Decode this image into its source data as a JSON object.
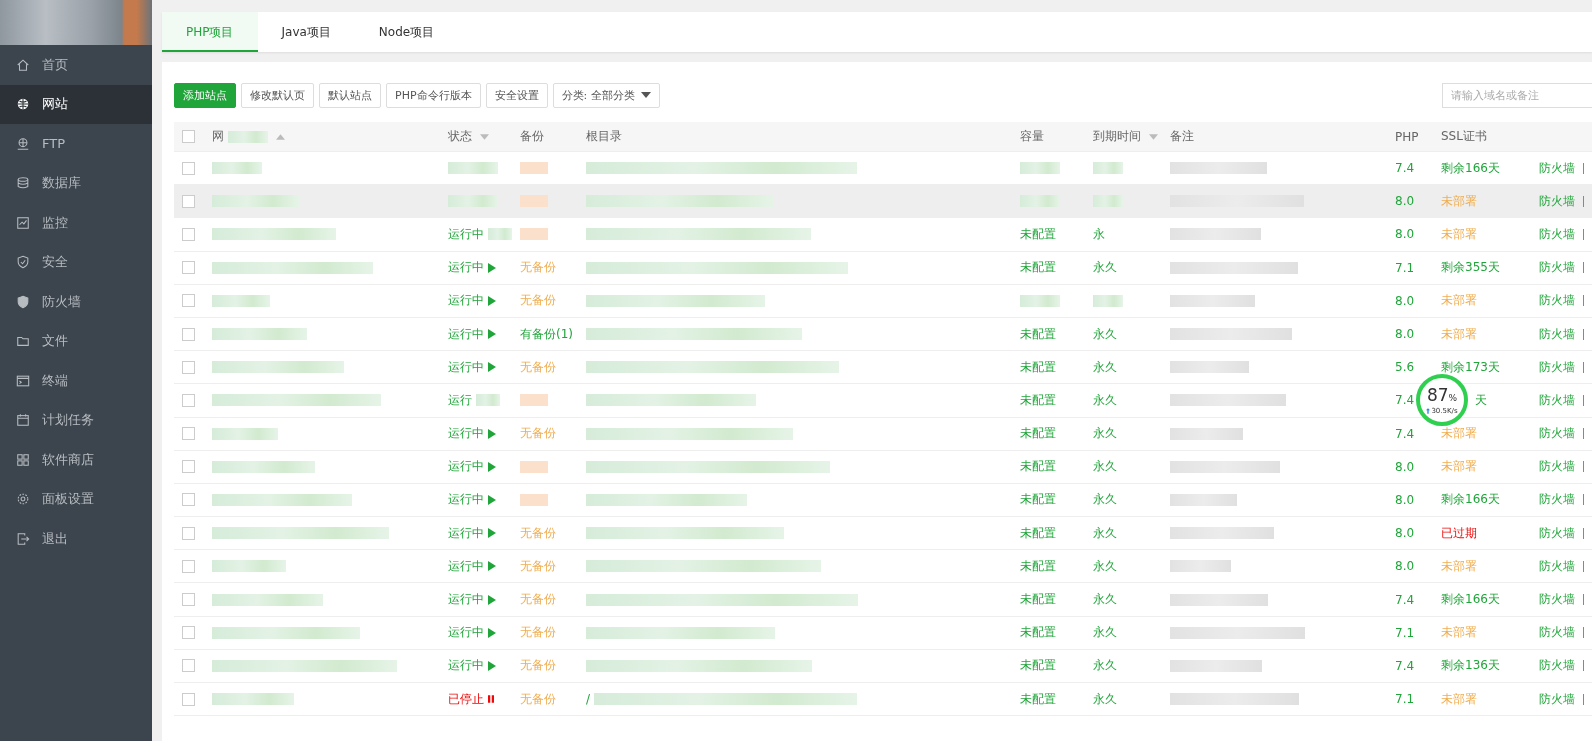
{
  "sidebar": {
    "items": [
      {
        "label": "首页",
        "selected": false
      },
      {
        "label": "网站",
        "selected": true
      },
      {
        "label": "FTP",
        "selected": false
      },
      {
        "label": "数据库",
        "selected": false
      },
      {
        "label": "监控",
        "selected": false
      },
      {
        "label": "安全",
        "selected": false
      },
      {
        "label": "防火墙",
        "selected": false
      },
      {
        "label": "文件",
        "selected": false
      },
      {
        "label": "终端",
        "selected": false
      },
      {
        "label": "计划任务",
        "selected": false
      },
      {
        "label": "软件商店",
        "selected": false
      },
      {
        "label": "面板设置",
        "selected": false
      },
      {
        "label": "退出",
        "selected": false
      }
    ]
  },
  "tabs": [
    {
      "label": "PHP项目",
      "selected": true
    },
    {
      "label": "Java项目",
      "selected": false
    },
    {
      "label": "Node项目",
      "selected": false
    }
  ],
  "toolbar": {
    "buttons": [
      {
        "label": "添加站点",
        "kind": "primary"
      },
      {
        "label": "修改默认页",
        "kind": "default"
      },
      {
        "label": "默认站点",
        "kind": "default"
      },
      {
        "label": "PHP命令行版本",
        "kind": "default"
      },
      {
        "label": "安全设置",
        "kind": "default"
      },
      {
        "label": "分类: 全部分类",
        "kind": "dropdown"
      }
    ],
    "search": {
      "placeholder": "请输入域名或备注"
    }
  },
  "table": {
    "header_checked": false,
    "columns": [
      {
        "label": "网",
        "sort_ascending": true
      },
      {
        "label": "状态",
        "sort_ascending": false
      },
      {
        "label": "备份"
      },
      {
        "label": "根目录"
      },
      {
        "label": "容量"
      },
      {
        "label": "到期时间",
        "sort_ascending": false
      },
      {
        "label": "备注"
      },
      {
        "label": "PHP"
      },
      {
        "label": "SSL证书"
      }
    ],
    "rows": [
      {
        "checked": false,
        "selected": false,
        "php": "7.4",
        "ssl": "剩余166天",
        "ssl_deployed": true,
        "ssl_expired": false,
        "actions": [
          "防火墙"
        ]
      },
      {
        "checked": false,
        "selected": true,
        "php": "8.0",
        "ssl": "未部署",
        "ssl_deployed": false,
        "ssl_expired": false,
        "actions": [
          "防火墙"
        ]
      },
      {
        "checked": false,
        "selected": false,
        "status": "运行中",
        "running": true,
        "partial": true,
        "capacity": "未配置",
        "expiry": "永",
        "php": "8.0",
        "ssl": "未部署",
        "ssl_deployed": false,
        "ssl_expired": false,
        "actions": [
          "防火墙"
        ]
      },
      {
        "checked": false,
        "selected": false,
        "status": "运行中",
        "running": true,
        "partial": false,
        "backup": "无备份",
        "has_backup": false,
        "capacity": "未配置",
        "expiry": "永久",
        "php": "7.1",
        "ssl": "剩余355天",
        "ssl_deployed": true,
        "ssl_expired": false,
        "actions": [
          "防火墙"
        ]
      },
      {
        "checked": false,
        "selected": false,
        "status": "运行中",
        "running": true,
        "partial": false,
        "backup": "无备份",
        "has_backup": false,
        "php": "8.0",
        "ssl": "未部署",
        "ssl_deployed": false,
        "ssl_expired": false,
        "actions": [
          "防火墙"
        ]
      },
      {
        "checked": false,
        "selected": false,
        "status": "运行中",
        "running": true,
        "partial": false,
        "backup": "有备份(1)",
        "has_backup": true,
        "capacity": "未配置",
        "expiry": "永久",
        "php": "8.0",
        "ssl": "未部署",
        "ssl_deployed": false,
        "ssl_expired": false,
        "actions": [
          "防火墙"
        ]
      },
      {
        "checked": false,
        "selected": false,
        "status": "运行中",
        "running": true,
        "partial": false,
        "backup": "无备份",
        "has_backup": false,
        "capacity": "未配置",
        "expiry": "永久",
        "php": "5.6",
        "ssl": "剩余173天",
        "ssl_deployed": true,
        "ssl_expired": false,
        "actions": [
          "防火墙"
        ]
      },
      {
        "checked": false,
        "selected": false,
        "status": "运行",
        "running": true,
        "partial": true,
        "capacity": "未配置",
        "expiry": "永久",
        "php": "7.4",
        "ssl": "天",
        "ssl_deployed": true,
        "ssl_expired": false,
        "actions": [
          "防火墙"
        ]
      },
      {
        "checked": false,
        "selected": false,
        "status": "运行中",
        "running": true,
        "partial": false,
        "backup": "无备份",
        "has_backup": false,
        "capacity": "未配置",
        "expiry": "永久",
        "php": "7.4",
        "ssl": "未部署",
        "ssl_deployed": false,
        "ssl_expired": false,
        "actions": [
          "防火墙"
        ]
      },
      {
        "checked": false,
        "selected": false,
        "status": "运行中",
        "running": true,
        "partial": false,
        "capacity": "未配置",
        "expiry": "永久",
        "php": "8.0",
        "ssl": "未部署",
        "ssl_deployed": false,
        "ssl_expired": false,
        "actions": [
          "防火墙"
        ]
      },
      {
        "checked": false,
        "selected": false,
        "status": "运行中",
        "running": true,
        "partial": false,
        "capacity": "未配置",
        "expiry": "永久",
        "php": "8.0",
        "ssl": "剩余166天",
        "ssl_deployed": true,
        "ssl_expired": false,
        "actions": [
          "防火墙"
        ]
      },
      {
        "checked": false,
        "selected": false,
        "status": "运行中",
        "running": true,
        "partial": false,
        "backup": "无备份",
        "has_backup": false,
        "capacity": "未配置",
        "expiry": "永久",
        "php": "8.0",
        "ssl": "已过期",
        "ssl_deployed": true,
        "ssl_expired": true,
        "actions": [
          "防火墙"
        ]
      },
      {
        "checked": false,
        "selected": false,
        "status": "运行中",
        "running": true,
        "partial": false,
        "backup": "无备份",
        "has_backup": false,
        "capacity": "未配置",
        "expiry": "永久",
        "php": "8.0",
        "ssl": "未部署",
        "ssl_deployed": false,
        "ssl_expired": false,
        "actions": [
          "防火墙"
        ]
      },
      {
        "checked": false,
        "selected": false,
        "status": "运行中",
        "running": true,
        "partial": false,
        "backup": "无备份",
        "has_backup": false,
        "capacity": "未配置",
        "expiry": "永久",
        "php": "7.4",
        "ssl": "剩余166天",
        "ssl_deployed": true,
        "ssl_expired": false,
        "actions": [
          "防火墙"
        ]
      },
      {
        "checked": false,
        "selected": false,
        "status": "运行中",
        "running": true,
        "partial": false,
        "backup": "无备份",
        "has_backup": false,
        "capacity": "未配置",
        "expiry": "永久",
        "php": "7.1",
        "ssl": "未部署",
        "ssl_deployed": false,
        "ssl_expired": false,
        "actions": [
          "防火墙"
        ]
      },
      {
        "checked": false,
        "selected": false,
        "status": "运行中",
        "running": true,
        "partial": false,
        "backup": "无备份",
        "has_backup": false,
        "capacity": "未配置",
        "expiry": "永久",
        "php": "7.4",
        "ssl": "剩余136天",
        "ssl_deployed": true,
        "ssl_expired": false,
        "actions": [
          "防火墙"
        ]
      },
      {
        "checked": false,
        "selected": false,
        "status": "已停止",
        "running": false,
        "partial": false,
        "backup": "无备份",
        "has_backup": false,
        "root": "/",
        "capacity": "未配置",
        "expiry": "永久",
        "php": "7.1",
        "ssl": "未部署",
        "ssl_deployed": false,
        "ssl_expired": false,
        "actions": [
          "防火墙"
        ]
      }
    ]
  },
  "monitor": {
    "percent": "87",
    "unit": "%",
    "speed": "30.5K/s"
  }
}
